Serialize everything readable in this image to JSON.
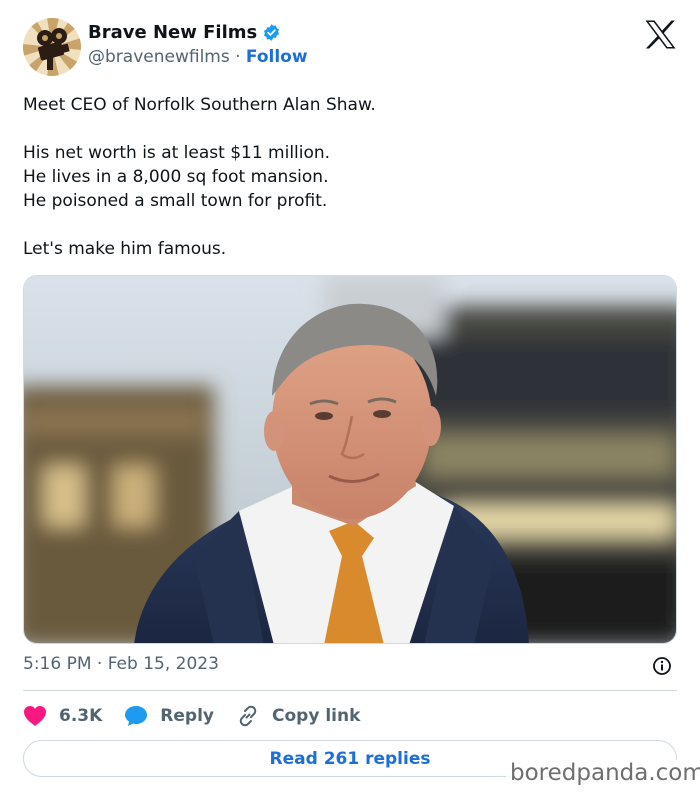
{
  "author": {
    "display_name": "Brave New Films",
    "handle": "@bravenewfilms",
    "separator": "·",
    "follow_label": "Follow",
    "avatar_icon": "film-camera-avatar",
    "verified_icon": "verified-badge-icon",
    "verified_color": "#1d9bf0"
  },
  "platform_logo": "x-logo",
  "tweet": {
    "lines": [
      "Meet CEO of Norfolk Southern Alan Shaw.",
      "His net worth is at least $11 million.",
      "He lives in a 8,000 sq foot mansion.",
      "He poisoned a small town for profit.",
      "Let's make him famous."
    ]
  },
  "meta": {
    "timestamp": "5:16 PM · Feb 15, 2023"
  },
  "actions": {
    "likes": "6.3K",
    "reply_label": "Reply",
    "copy_link_label": "Copy link",
    "like_color": "#f91880",
    "reply_color": "#1d9bf0"
  },
  "read_replies_label": "Read 261 replies",
  "watermark": "boredpanda.com",
  "colors": {
    "link_blue": "#1d6fd8",
    "secondary_text": "#536471",
    "border": "#cfd9de"
  }
}
